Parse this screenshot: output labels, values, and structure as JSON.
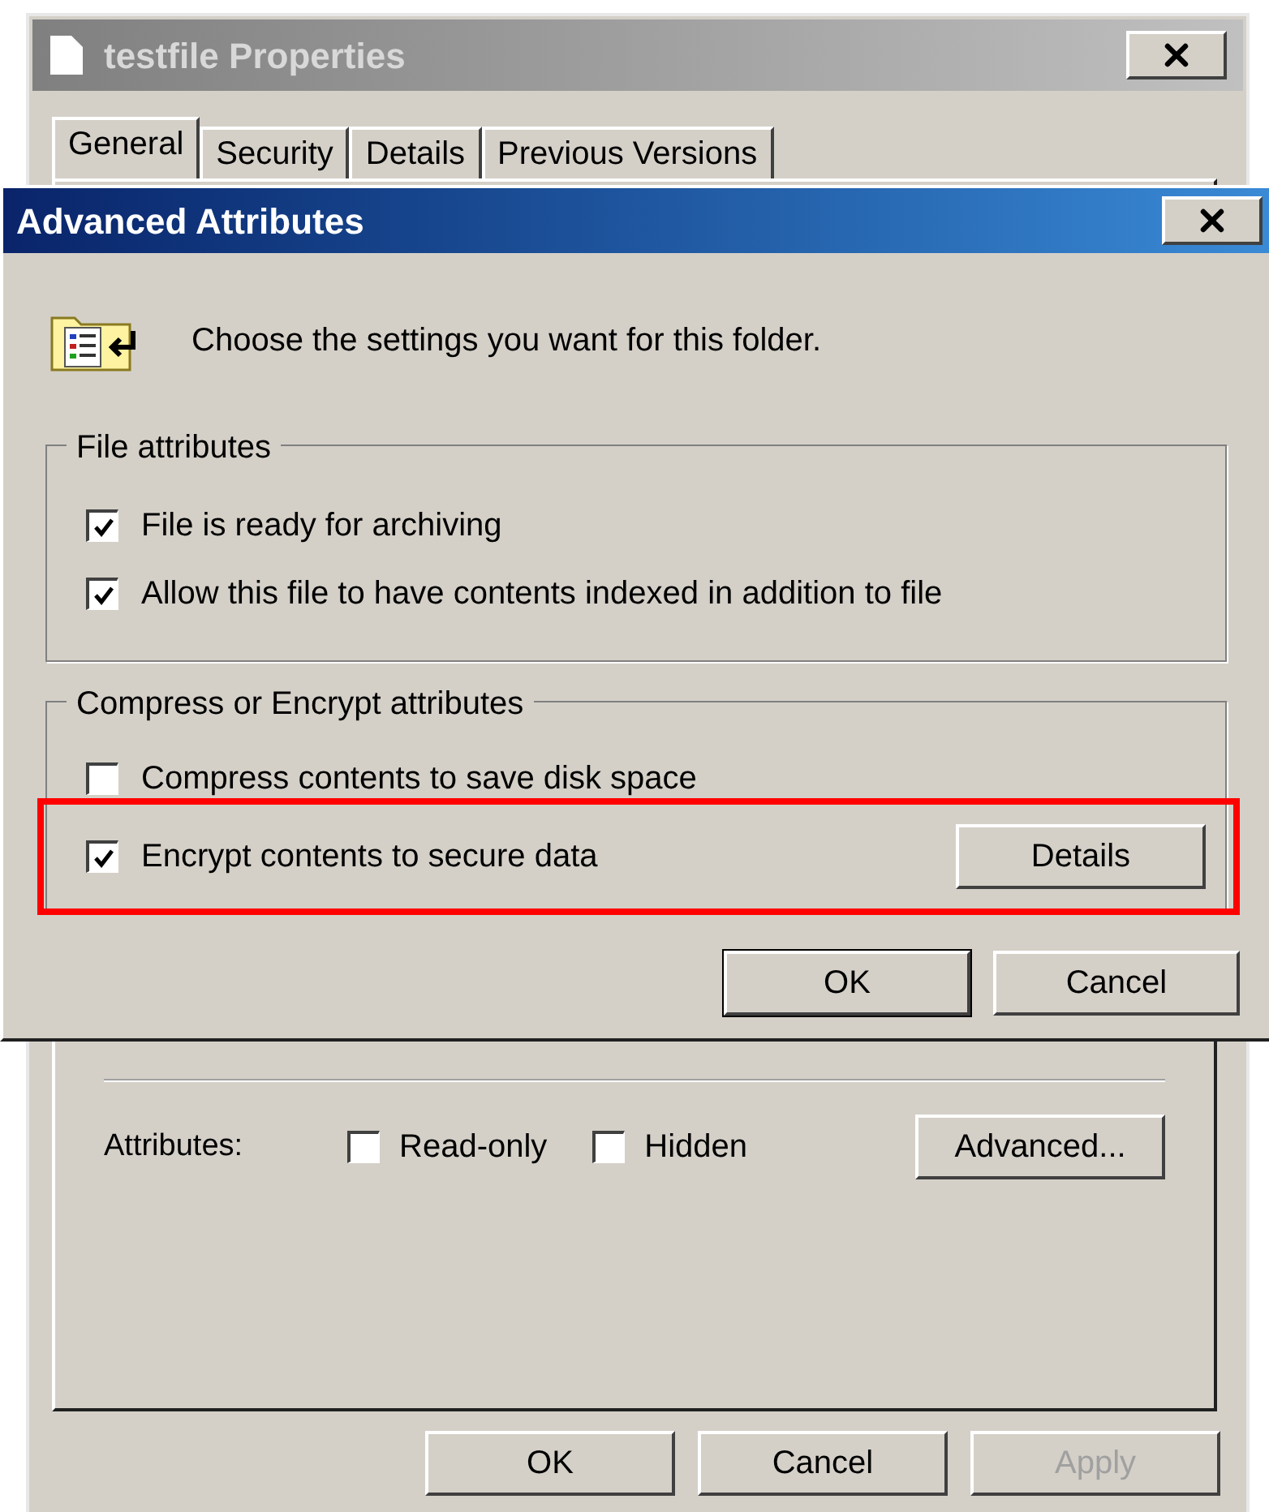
{
  "properties_window": {
    "title": "testfile Properties",
    "tabs": [
      {
        "label": "General",
        "selected": true
      },
      {
        "label": "Security",
        "selected": false
      },
      {
        "label": "Details",
        "selected": false
      },
      {
        "label": "Previous Versions",
        "selected": false
      }
    ],
    "attributes": {
      "label": "Attributes:",
      "options": [
        {
          "label": "Read-only",
          "checked": false
        },
        {
          "label": "Hidden",
          "checked": false
        }
      ],
      "button": "Advanced..."
    },
    "buttons": [
      {
        "label": "OK",
        "disabled": false
      },
      {
        "label": "Cancel",
        "disabled": false
      },
      {
        "label": "Apply",
        "disabled": true
      }
    ]
  },
  "advanced_dialog": {
    "title": "Advanced Attributes",
    "message": "Choose the settings you want for this folder.",
    "groups": [
      {
        "title": "File attributes",
        "options": [
          {
            "label": "File is ready for archiving",
            "checked": true
          },
          {
            "label": "Allow this file to have contents indexed in addition to file",
            "checked": true
          }
        ]
      },
      {
        "title": "Compress or Encrypt attributes",
        "options": [
          {
            "label": "Compress contents to save disk space",
            "checked": false
          },
          {
            "label": "Encrypt contents to secure data",
            "checked": true,
            "button": "Details"
          }
        ]
      }
    ],
    "buttons": [
      {
        "label": "OK",
        "disabled": false
      },
      {
        "label": "Cancel",
        "disabled": false
      }
    ]
  }
}
